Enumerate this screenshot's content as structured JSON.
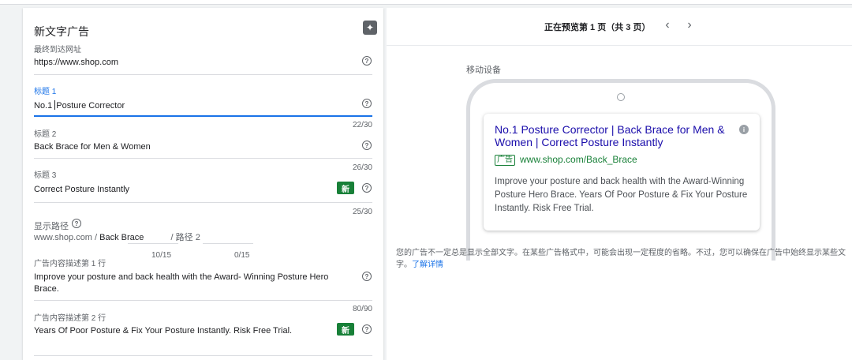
{
  "form": {
    "title": "新文字广告",
    "final_url": {
      "label": "最终到达网址",
      "value": "https://www.shop.com"
    },
    "headline1": {
      "label": "标题 1",
      "value_before_caret": "No.1 ",
      "value_after_caret": "Posture Corrector",
      "count": "22/30"
    },
    "headline2": {
      "label": "标题 2",
      "value": "Back Brace for Men & Women",
      "count": "26/30"
    },
    "headline3": {
      "label": "标题 3",
      "value": "Correct Posture Instantly",
      "count": "25/30",
      "badge": "新"
    },
    "display_path": {
      "label": "显示路径",
      "domain": "www.shop.com /",
      "path1": "Back Brace",
      "path2_placeholder": "/ 路径 2",
      "count1": "10/15",
      "count2": "0/15"
    },
    "description1": {
      "label": "广告内容描述第 1 行",
      "value": "Improve your posture and back health with the Award- Winning Posture Hero Brace.",
      "count": "80/90"
    },
    "description2": {
      "label": "广告内容描述第 2 行",
      "value": "Years Of Poor Posture & Fix Your Posture Instantly. Risk Free Trial.",
      "badge": "新"
    },
    "help_glyph": "?",
    "magic_glyph": "✦"
  },
  "preview": {
    "header": "正在预览第 1 页（共 3 页）",
    "prev": "‹",
    "next": "›",
    "device_label": "移动设备",
    "ad": {
      "title": "No.1 Posture Corrector | Back Brace for Men & Women | Correct Posture Instantly",
      "badge": "广告",
      "url": "www.shop.com/Back_Brace",
      "description": "Improve your posture and back health with the Award-Winning Posture Hero Brace. Years Of Poor Posture & Fix Your Posture Instantly. Risk Free Trial.",
      "info_glyph": "i"
    },
    "note": "您的广告不一定总是显示全部文字。在某些广告格式中，可能会出现一定程度的省略。不过，您可以确保在广告中始终显示某些文字。",
    "learn_more": "了解详情"
  },
  "colors": {
    "accent": "#1a73e8",
    "new_badge": "#188038",
    "ad_title": "#1a0dab"
  }
}
